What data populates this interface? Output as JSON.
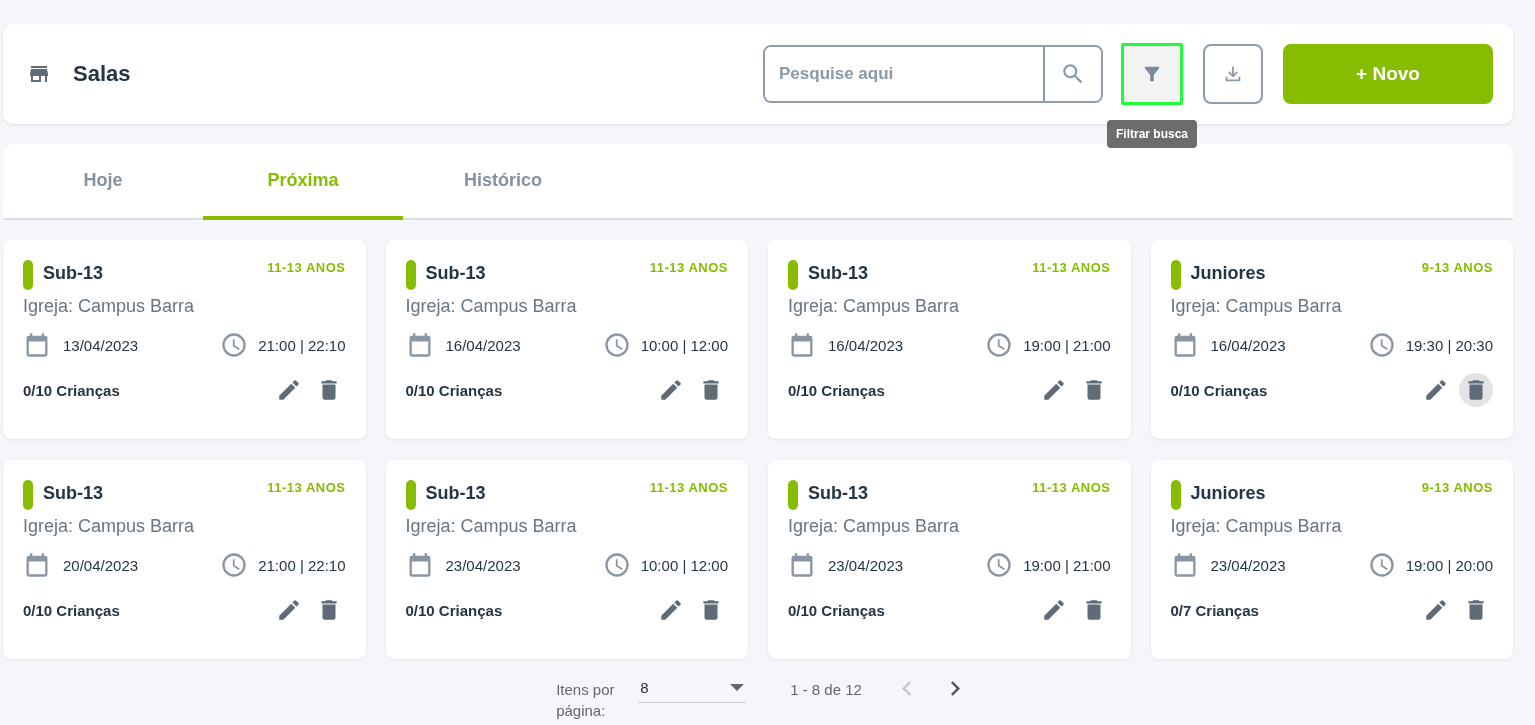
{
  "header": {
    "title": "Salas",
    "search": {
      "placeholder": "Pesquise aqui"
    },
    "filter_button": {
      "focused": true,
      "tooltip": "Filtrar busca"
    },
    "new_button": {
      "label": "+ Novo"
    }
  },
  "tabs": [
    {
      "label": "Hoje",
      "selected": false
    },
    {
      "label": "Próxima",
      "selected": true
    },
    {
      "label": "Histórico",
      "selected": false
    }
  ],
  "cards": [
    {
      "name": "Sub-13",
      "age": "11-13 ANOS",
      "church": "Igreja: Campus Barra",
      "date": "13/04/2023",
      "time": "21:00 | 22:10",
      "count": "0/10 Crianças",
      "delete_hovered": false
    },
    {
      "name": "Sub-13",
      "age": "11-13 ANOS",
      "church": "Igreja: Campus Barra",
      "date": "16/04/2023",
      "time": "10:00 | 12:00",
      "count": "0/10 Crianças",
      "delete_hovered": false
    },
    {
      "name": "Sub-13",
      "age": "11-13 ANOS",
      "church": "Igreja: Campus Barra",
      "date": "16/04/2023",
      "time": "19:00 | 21:00",
      "count": "0/10 Crianças",
      "delete_hovered": false
    },
    {
      "name": "Juniores",
      "age": "9-13 ANOS",
      "church": "Igreja: Campus Barra",
      "date": "16/04/2023",
      "time": "19:30 | 20:30",
      "count": "0/10 Crianças",
      "delete_hovered": true
    },
    {
      "name": "Sub-13",
      "age": "11-13 ANOS",
      "church": "Igreja: Campus Barra",
      "date": "20/04/2023",
      "time": "21:00 | 22:10",
      "count": "0/10 Crianças",
      "delete_hovered": false
    },
    {
      "name": "Sub-13",
      "age": "11-13 ANOS",
      "church": "Igreja: Campus Barra",
      "date": "23/04/2023",
      "time": "10:00 | 12:00",
      "count": "0/10 Crianças",
      "delete_hovered": false
    },
    {
      "name": "Sub-13",
      "age": "11-13 ANOS",
      "church": "Igreja: Campus Barra",
      "date": "23/04/2023",
      "time": "19:00 | 21:00",
      "count": "0/10 Crianças",
      "delete_hovered": false
    },
    {
      "name": "Juniores",
      "age": "9-13 ANOS",
      "church": "Igreja: Campus Barra",
      "date": "23/04/2023",
      "time": "19:00 | 20:00",
      "count": "0/7 Crianças",
      "delete_hovered": false
    }
  ],
  "pagination": {
    "items_label": "Itens por página:",
    "page_size": "8",
    "range": "1 - 8 de 12",
    "prev_disabled": true,
    "next_disabled": false
  }
}
